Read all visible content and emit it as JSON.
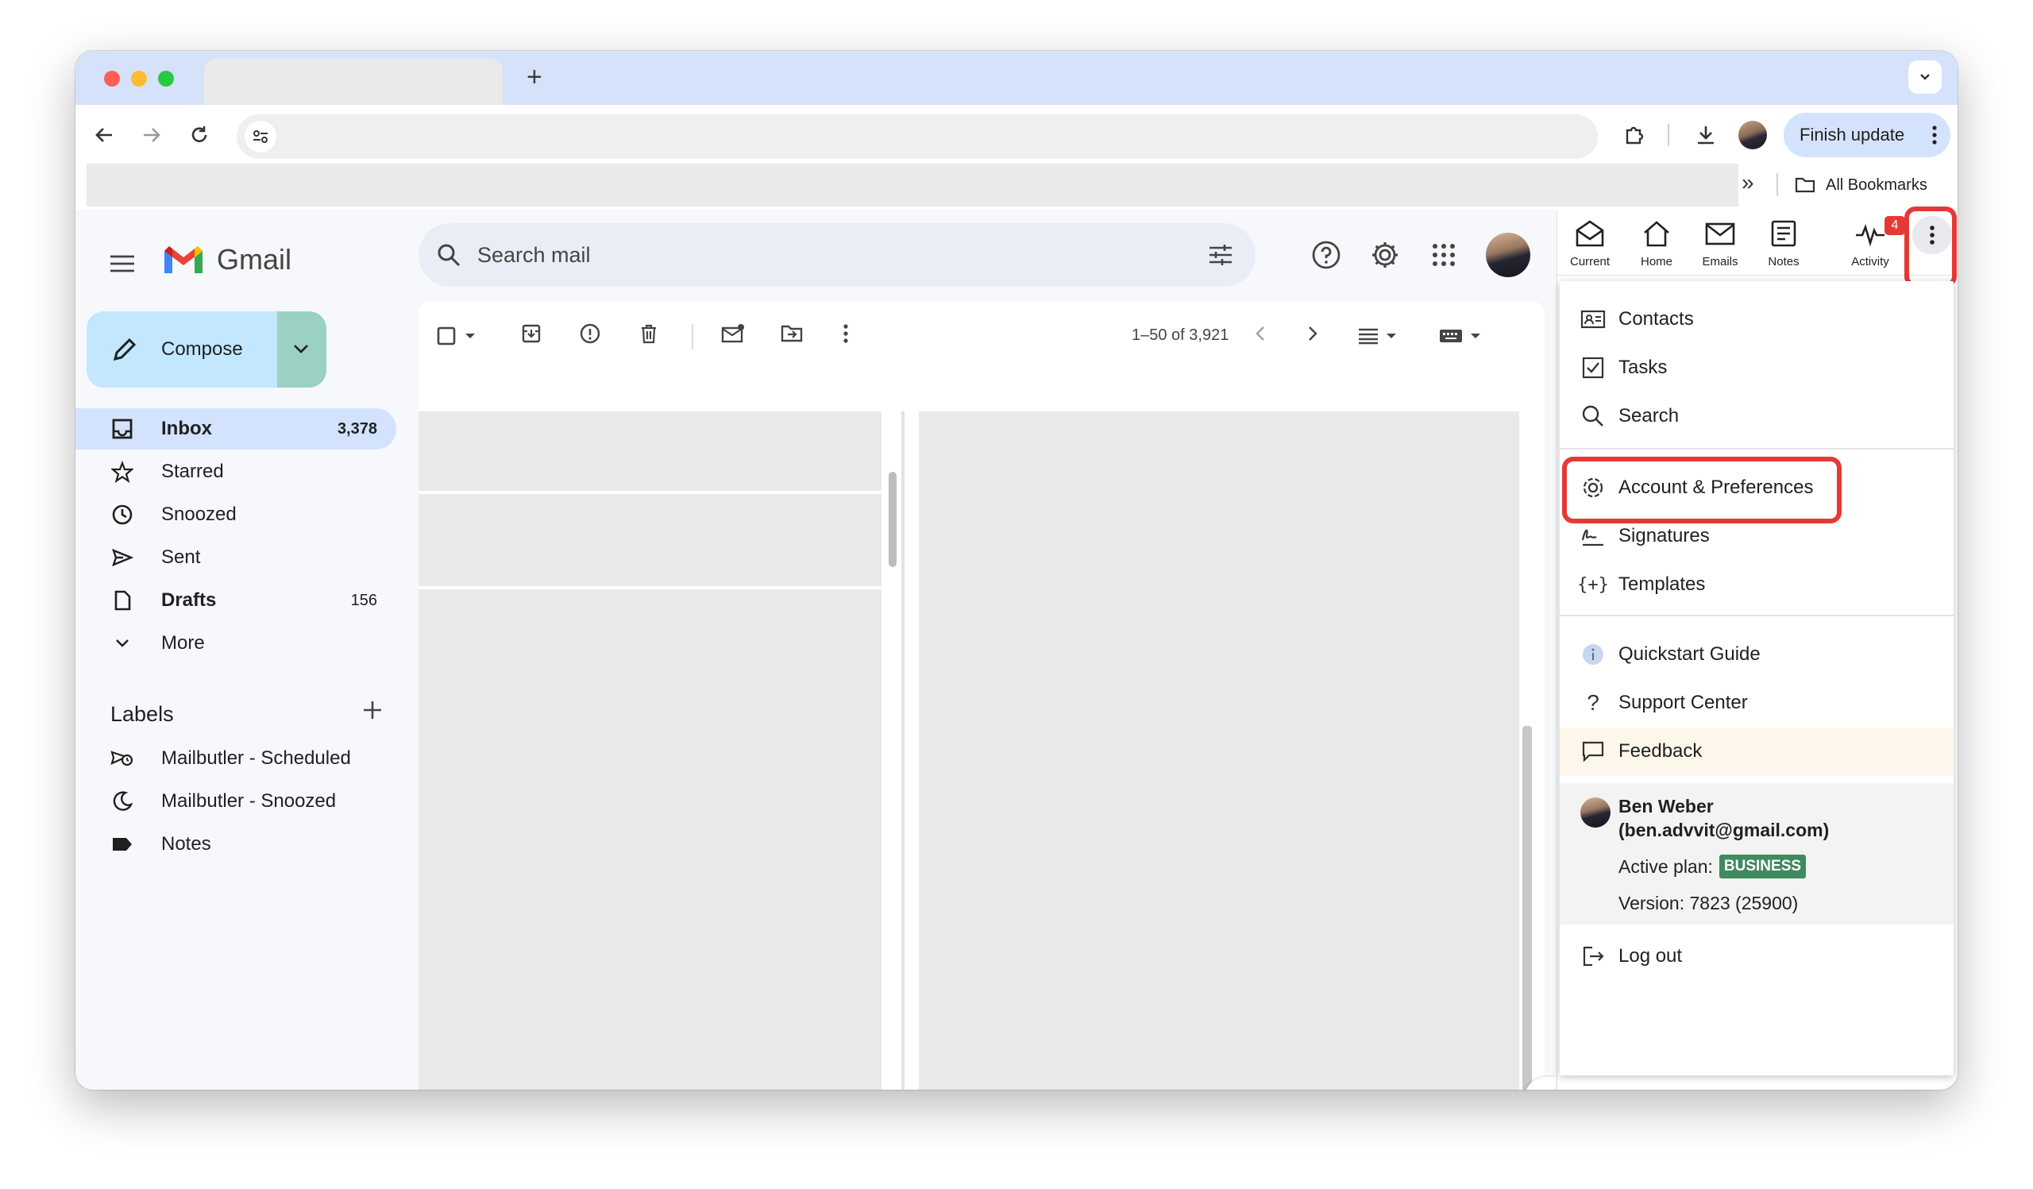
{
  "browser": {
    "new_tab_symbol": "+",
    "finish_update_label": "Finish update",
    "overflow_chevron": "»",
    "all_bookmarks_label": "All Bookmarks"
  },
  "gmail": {
    "app_name": "Gmail",
    "search_placeholder": "Search mail",
    "compose_label": "Compose",
    "nav": [
      {
        "label": "Inbox",
        "count": "3,378",
        "icon": "inbox-icon"
      },
      {
        "label": "Starred",
        "count": "",
        "icon": "star-icon"
      },
      {
        "label": "Snoozed",
        "count": "",
        "icon": "clock-icon"
      },
      {
        "label": "Sent",
        "count": "",
        "icon": "send-icon"
      },
      {
        "label": "Drafts",
        "count": "156",
        "icon": "draft-icon"
      },
      {
        "label": "More",
        "count": "",
        "icon": "chevron-down-icon"
      }
    ],
    "labels_header": "Labels",
    "labels": [
      {
        "label": "Mailbutler - Scheduled",
        "icon": "scheduled-send-icon"
      },
      {
        "label": "Mailbutler - Snoozed",
        "icon": "moon-icon"
      },
      {
        "label": "Notes",
        "icon": "label-icon"
      }
    ],
    "pagination": "1–50 of 3,921"
  },
  "sidebar": {
    "tabs": [
      {
        "label": "Current",
        "icon": "envelope-open-icon"
      },
      {
        "label": "Home",
        "icon": "home-icon"
      },
      {
        "label": "Emails",
        "icon": "mail-icon"
      },
      {
        "label": "Notes",
        "icon": "notes-icon"
      },
      {
        "label": "Activity",
        "icon": "activity-icon",
        "badge": "4"
      }
    ],
    "menu": {
      "group1": [
        {
          "label": "Contacts",
          "icon": "contacts-icon"
        },
        {
          "label": "Tasks",
          "icon": "tasks-icon"
        },
        {
          "label": "Search",
          "icon": "search-icon"
        }
      ],
      "group2": [
        {
          "label": "Account & Preferences",
          "icon": "gear-icon"
        },
        {
          "label": "Signatures",
          "icon": "signature-icon"
        },
        {
          "label": "Templates",
          "icon": "templates-icon"
        }
      ],
      "group3": [
        {
          "label": "Quickstart Guide",
          "icon": "info-icon"
        },
        {
          "label": "Support Center",
          "icon": "question-icon"
        },
        {
          "label": "Feedback",
          "icon": "feedback-icon"
        }
      ],
      "account": {
        "name": "Ben Weber",
        "email": "(ben.advvit@gmail.com)",
        "plan_label": "Active plan:",
        "plan_value": "BUSINESS",
        "version": "Version: 7823 (25900)"
      },
      "logout_label": "Log out"
    }
  },
  "colors": {
    "highlight_red": "#e53935",
    "inbox_selected": "#d3e3fd",
    "compose_bg": "#c2e7ff",
    "plan_badge": "#3f8a5f",
    "badge_red": "#e53935"
  }
}
